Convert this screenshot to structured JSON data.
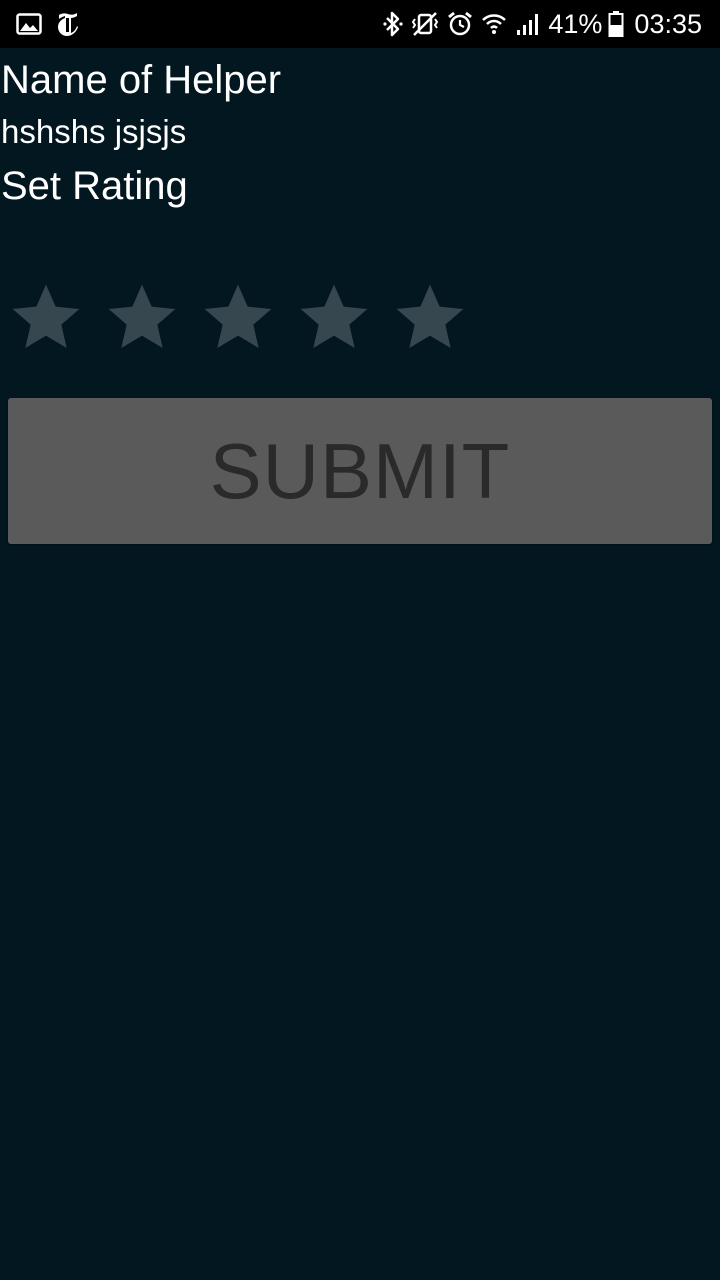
{
  "status_bar": {
    "left_icons": [
      "image-icon",
      "nyt-icon"
    ],
    "right_icons": [
      "bluetooth-icon",
      "vibrate-icon",
      "alarm-icon",
      "wifi-icon",
      "signal-icon",
      "battery-icon"
    ],
    "battery_percent": "41%",
    "time": "03:35"
  },
  "screen": {
    "title": "Name of Helper",
    "helper_name": "hshshs jsjsjs",
    "rating_label": "Set Rating",
    "rating": {
      "value": 0,
      "max": 5
    },
    "submit_label": "SUBMIT"
  },
  "colors": {
    "background": "#021720",
    "status_bar": "#000000",
    "star_empty": "#37474f",
    "button_bg": "#5a5a5a",
    "button_text": "#2a2a2a",
    "text": "#ffffff"
  }
}
